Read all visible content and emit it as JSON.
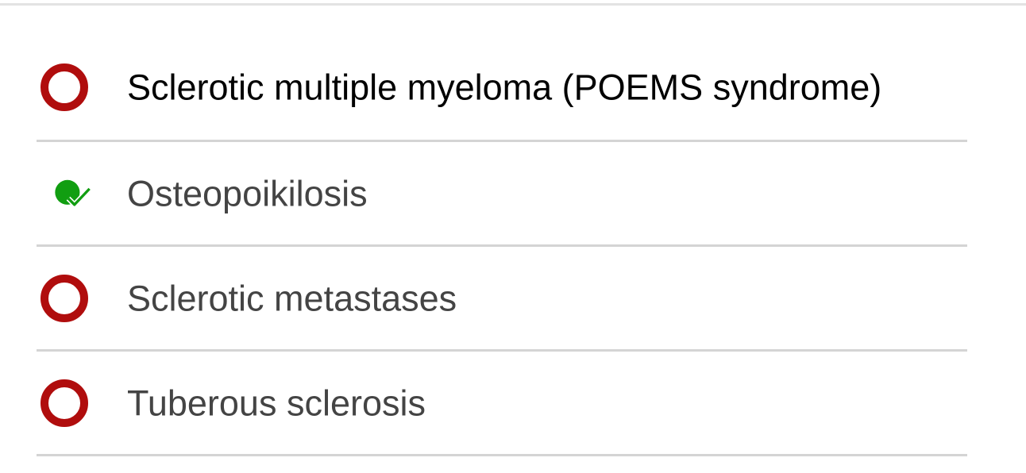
{
  "answer_options": [
    {
      "label": "Sclerotic multiple myeloma (POEMS syndrome)",
      "icon": "incorrect-ring-icon",
      "selected": true
    },
    {
      "label": "Osteopoikilosis",
      "icon": "correct-check-icon",
      "selected": false
    },
    {
      "label": "Sclerotic metastases",
      "icon": "incorrect-ring-icon",
      "selected": false
    },
    {
      "label": "Tuberous sclerosis",
      "icon": "incorrect-ring-icon",
      "selected": false
    }
  ],
  "colors": {
    "incorrect": "#b00d0d",
    "correct": "#119e11",
    "divider": "#d4d4d4"
  }
}
